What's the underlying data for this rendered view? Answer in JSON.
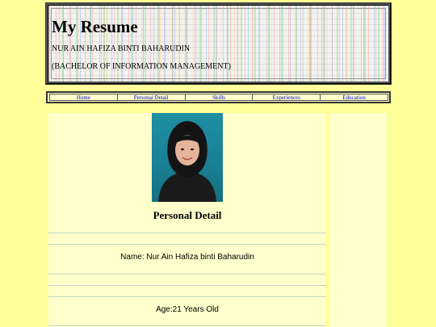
{
  "header": {
    "title": "My Resume",
    "name": "NUR AIN HAFIZA BINTI BAHARUDIN",
    "degree": "(BACHELOR OF INFORMATION MANAGEMENT)"
  },
  "nav": {
    "items": [
      {
        "label": "Home"
      },
      {
        "label": "Personal Detail"
      },
      {
        "label": "Skills"
      },
      {
        "label": "Experiences"
      },
      {
        "label": "Education"
      }
    ]
  },
  "colors": {
    "page_background": "#ffff99",
    "panel_background": "#ffffcc",
    "link": "#0000cc"
  },
  "main": {
    "section_title": "Personal Detail",
    "details": [
      {
        "text": "Name: Nur Ain Hafiza binti Baharudin"
      },
      {
        "text": "Age:21 Years Old"
      }
    ]
  }
}
